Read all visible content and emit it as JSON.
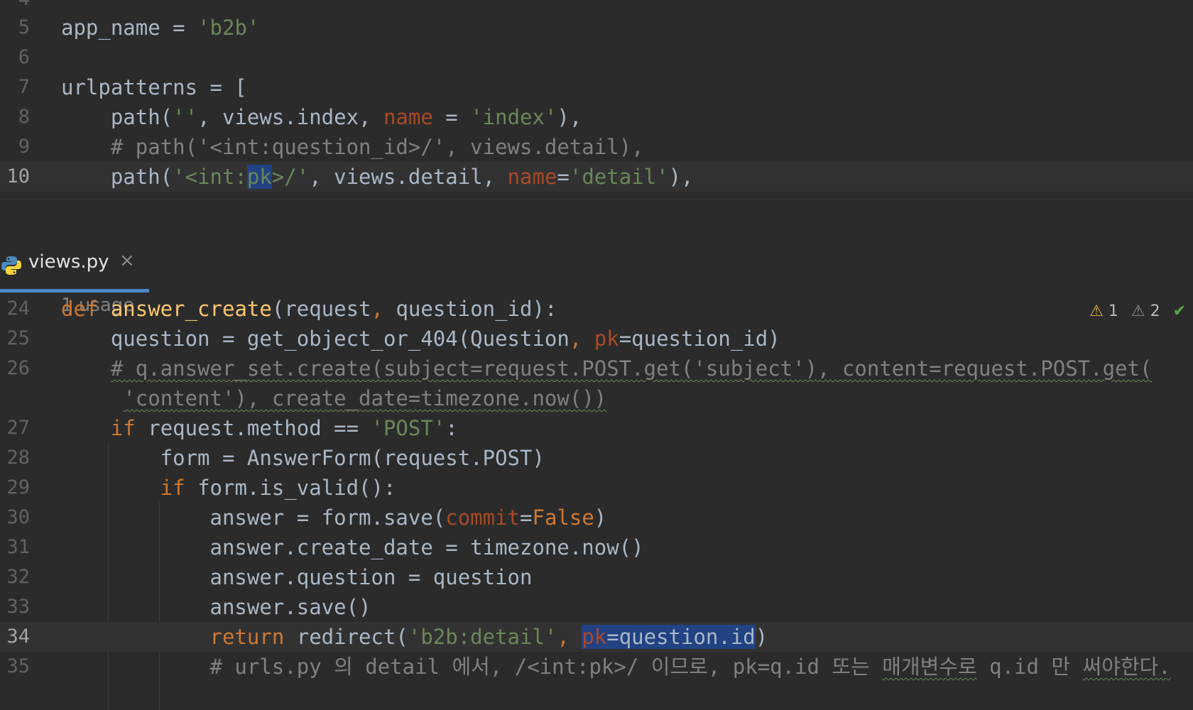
{
  "top_editor": {
    "partial_line_number_top": "4",
    "lines": [
      {
        "number": "5",
        "segments": [
          {
            "t": "app_name = ",
            "c": ""
          },
          {
            "t": "'b2b'",
            "c": "str"
          }
        ]
      },
      {
        "number": "6",
        "segments": []
      },
      {
        "number": "7",
        "segments": [
          {
            "t": "urlpatterns = [",
            "c": ""
          }
        ]
      },
      {
        "number": "8",
        "segments": [
          {
            "t": "    path(",
            "c": ""
          },
          {
            "t": "''",
            "c": "str"
          },
          {
            "t": ", views.index, ",
            "c": ""
          },
          {
            "t": "name",
            "c": "param"
          },
          {
            "t": " = ",
            "c": ""
          },
          {
            "t": "'index'",
            "c": "str"
          },
          {
            "t": "),",
            "c": ""
          }
        ]
      },
      {
        "number": "9",
        "segments": [
          {
            "t": "    # path('<int:question_id>/', views.detail),",
            "c": "cm"
          }
        ]
      },
      {
        "number": "10",
        "current": true,
        "segments": [
          {
            "t": "    path(",
            "c": ""
          },
          {
            "t": "'<int:",
            "c": "str"
          },
          {
            "t": "pk",
            "c": "str hl"
          },
          {
            "t": ">/'",
            "c": "str"
          },
          {
            "t": ", views.detail, ",
            "c": ""
          },
          {
            "t": "name",
            "c": "param"
          },
          {
            "t": "=",
            "c": ""
          },
          {
            "t": "'detail'",
            "c": "str"
          },
          {
            "t": "),",
            "c": ""
          }
        ]
      }
    ]
  },
  "tab": {
    "filename": "views.py",
    "close_glyph": "×",
    "active": true
  },
  "bottom_editor": {
    "usage_hint": "1 usage",
    "inspections": {
      "warnings": "1",
      "weak_warnings": "2",
      "warning_glyph": "⚠",
      "ok_glyph": "✔"
    },
    "lines": [
      {
        "number": "24",
        "segments": [
          {
            "t": "def ",
            "c": "kw"
          },
          {
            "t": "answer_create",
            "c": "fn"
          },
          {
            "t": "(request",
            "c": ""
          },
          {
            "t": ", ",
            "c": "kw"
          },
          {
            "t": "question_id):",
            "c": ""
          }
        ]
      },
      {
        "number": "25",
        "segments": [
          {
            "t": "    question = get_object_or_404(Question",
            "c": ""
          },
          {
            "t": ", ",
            "c": "kw"
          },
          {
            "t": "pk",
            "c": "param"
          },
          {
            "t": "=question_id)",
            "c": ""
          }
        ]
      },
      {
        "number": "26",
        "segments": [
          {
            "t": "    ",
            "c": ""
          },
          {
            "t": "# q.answer_set.create(subject=request.POST.get('subject'), content=request.POST.get(",
            "c": "cm sq"
          }
        ]
      },
      {
        "number": "",
        "segments": [
          {
            "t": "     ",
            "c": ""
          },
          {
            "t": "'content'), create_date=timezone.now())",
            "c": "cm sq"
          }
        ]
      },
      {
        "number": "27",
        "segments": [
          {
            "t": "    ",
            "c": ""
          },
          {
            "t": "if ",
            "c": "kw"
          },
          {
            "t": "request.method == ",
            "c": ""
          },
          {
            "t": "'POST'",
            "c": "str"
          },
          {
            "t": ":",
            "c": ""
          }
        ]
      },
      {
        "number": "28",
        "segments": [
          {
            "t": "        form = AnswerForm(request.POST)",
            "c": ""
          }
        ]
      },
      {
        "number": "29",
        "segments": [
          {
            "t": "        ",
            "c": ""
          },
          {
            "t": "if ",
            "c": "kw"
          },
          {
            "t": "form.is_valid():",
            "c": ""
          }
        ]
      },
      {
        "number": "30",
        "segments": [
          {
            "t": "            answer = form.save(",
            "c": ""
          },
          {
            "t": "commit",
            "c": "param"
          },
          {
            "t": "=",
            "c": ""
          },
          {
            "t": "False",
            "c": "kw"
          },
          {
            "t": ")",
            "c": ""
          }
        ]
      },
      {
        "number": "31",
        "segments": [
          {
            "t": "            answer.create_date = timezone.now()",
            "c": ""
          }
        ]
      },
      {
        "number": "32",
        "segments": [
          {
            "t": "            answer.question = question",
            "c": ""
          }
        ]
      },
      {
        "number": "33",
        "segments": [
          {
            "t": "            answer.save()",
            "c": ""
          }
        ]
      },
      {
        "number": "34",
        "current": true,
        "segments": [
          {
            "t": "            ",
            "c": ""
          },
          {
            "t": "return ",
            "c": "kw"
          },
          {
            "t": "redirect(",
            "c": ""
          },
          {
            "t": "'b2b:detail'",
            "c": "str"
          },
          {
            "t": ", ",
            "c": "kw"
          },
          {
            "t": "pk",
            "c": "param hl"
          },
          {
            "t": "=question.id",
            "c": "hl"
          },
          {
            "t": ")",
            "c": ""
          }
        ]
      },
      {
        "number": "35",
        "segments": [
          {
            "t": "            # urls.py 의 detail 에서, /<int:pk>/ 이므로, pk=q.id 또는 ",
            "c": "cm"
          },
          {
            "t": "매개변수로",
            "c": "cm sq"
          },
          {
            "t": " q.id 만 ",
            "c": "cm"
          },
          {
            "t": "써야한다.",
            "c": "cm sq"
          }
        ]
      }
    ]
  }
}
